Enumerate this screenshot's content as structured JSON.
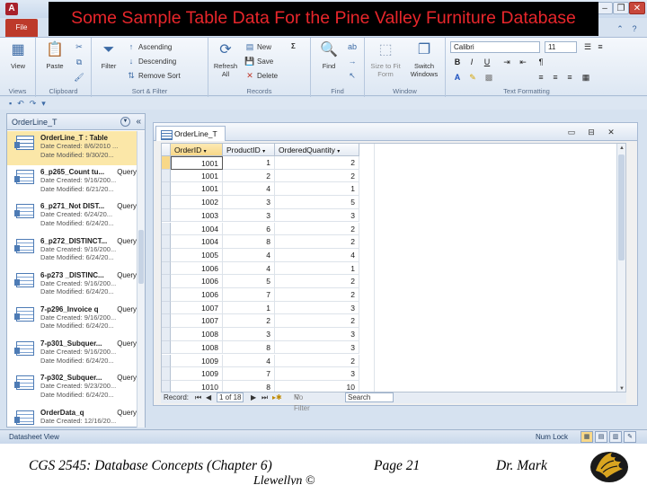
{
  "slide": {
    "title": "Some Sample Table Data For the Pine Valley Furniture Database",
    "footer_left": "CGS 2545: Database Concepts  (Chapter 6)",
    "footer_center": "Page 21",
    "footer_right": "Dr. Mark",
    "footer_sub": "Llewellyn ©"
  },
  "app": {
    "icon_letter": "A",
    "file_tab": "File",
    "window_controls": {
      "minimize": "–",
      "restore": "❐",
      "close": "✕"
    }
  },
  "ribbon": {
    "views": {
      "view_label": "View",
      "group": "Views"
    },
    "clipboard": {
      "paste_label": "Paste",
      "group": "Clipboard"
    },
    "sort_filter": {
      "filter_label": "Filter",
      "ascending": "Ascending",
      "descending": "Descending",
      "remove_sort": "Remove Sort",
      "group": "Sort & Filter"
    },
    "records": {
      "refresh_label": "Refresh All",
      "new": "New",
      "save": "Save",
      "delete": "Delete",
      "totals": "Σ",
      "group": "Records"
    },
    "find": {
      "find_label": "Find",
      "group": "Find"
    },
    "window": {
      "size_label": "Size to Fit Form",
      "switch_label": "Switch Windows",
      "group": "Window"
    },
    "text_formatting": {
      "font": "Calibri",
      "size": "11",
      "bold": "B",
      "italic": "I",
      "underline": "U",
      "group": "Text Formatting"
    }
  },
  "nav_pane": {
    "header": "OrderLine_T",
    "items": [
      {
        "name": "OrderLine_T : Table",
        "type": "",
        "created": "Date Created: 8/6/2010 ...",
        "modified": "Date Modified: 9/30/20...",
        "selected": true,
        "kind": "table"
      },
      {
        "name": "6_p265_Count tu...",
        "type": "Query",
        "created": "Date Created: 9/16/200...",
        "modified": "Date Modified: 6/21/20...",
        "selected": false,
        "kind": "query"
      },
      {
        "name": "6_p271_Not DIST...",
        "type": "Query",
        "created": "Date Created: 6/24/20...",
        "modified": "Date Modified: 6/24/20...",
        "selected": false,
        "kind": "query"
      },
      {
        "name": "6_p272_DISTINCT...",
        "type": "Query",
        "created": "Date Created: 9/16/200...",
        "modified": "Date Modified: 6/24/20...",
        "selected": false,
        "kind": "query"
      },
      {
        "name": "6-p273 _DISTINC...",
        "type": "Query",
        "created": "Date Created: 9/16/200...",
        "modified": "Date Modified: 6/24/20...",
        "selected": false,
        "kind": "query"
      },
      {
        "name": "7-p296_Invoice q",
        "type": "Query",
        "created": "Date Created: 9/16/200...",
        "modified": "Date Modified: 6/24/20...",
        "selected": false,
        "kind": "query"
      },
      {
        "name": "7-p301_Subquer...",
        "type": "Query",
        "created": "Date Created: 9/16/200...",
        "modified": "Date Modified: 6/24/20...",
        "selected": false,
        "kind": "query"
      },
      {
        "name": "7-p302_Subquer...",
        "type": "Query",
        "created": "Date Created: 9/23/200...",
        "modified": "Date Modified: 6/24/20...",
        "selected": false,
        "kind": "query"
      },
      {
        "name": "OrderData_q",
        "type": "Query",
        "created": "Date Created: 12/16/20...",
        "modified": "",
        "selected": false,
        "kind": "query"
      }
    ]
  },
  "document": {
    "tab_label": "OrderLine_T",
    "columns": [
      "OrderID",
      "ProductID",
      "OrderedQuantity"
    ],
    "rows": [
      [
        "1001",
        "1",
        "2"
      ],
      [
        "1001",
        "2",
        "2"
      ],
      [
        "1001",
        "4",
        "1"
      ],
      [
        "1002",
        "3",
        "5"
      ],
      [
        "1003",
        "3",
        "3"
      ],
      [
        "1004",
        "6",
        "2"
      ],
      [
        "1004",
        "8",
        "2"
      ],
      [
        "1005",
        "4",
        "4"
      ],
      [
        "1006",
        "4",
        "1"
      ],
      [
        "1006",
        "5",
        "2"
      ],
      [
        "1006",
        "7",
        "2"
      ],
      [
        "1007",
        "1",
        "3"
      ],
      [
        "1007",
        "2",
        "2"
      ],
      [
        "1008",
        "3",
        "3"
      ],
      [
        "1008",
        "8",
        "3"
      ],
      [
        "1009",
        "4",
        "2"
      ],
      [
        "1009",
        "7",
        "3"
      ],
      [
        "1010",
        "8",
        "10"
      ]
    ],
    "record_nav": {
      "record_label": "Record:",
      "position": "1 of 18",
      "filter": "No Filter",
      "search": "Search"
    }
  },
  "status_bar": {
    "left": "Datasheet View",
    "right": "Num Lock"
  }
}
